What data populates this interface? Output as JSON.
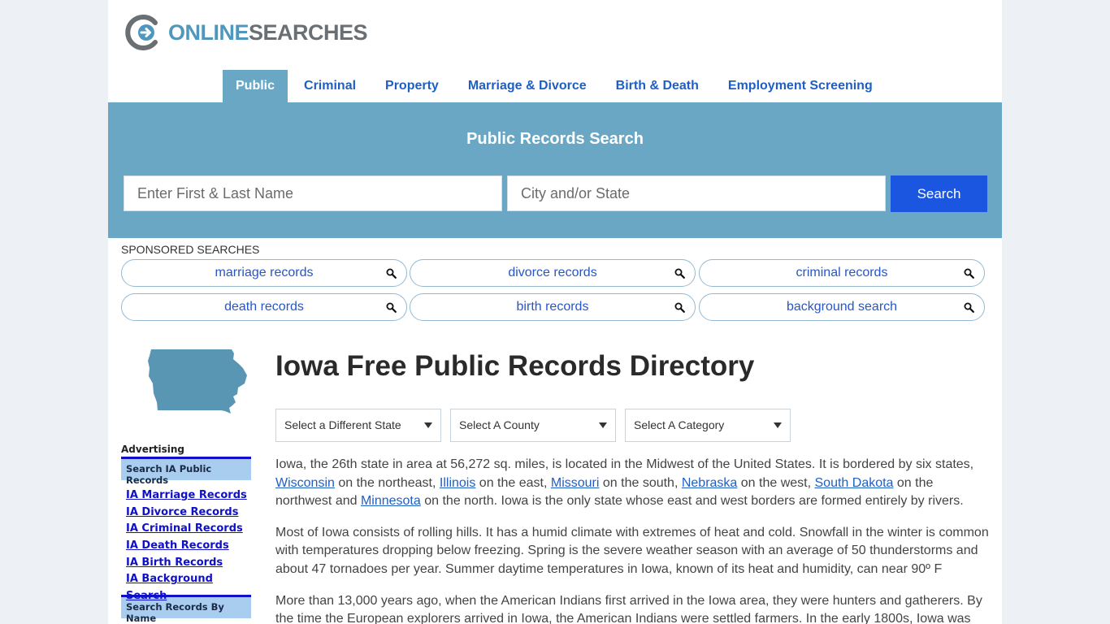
{
  "brand": {
    "online": "ONLINE",
    "searches": "SEARCHES",
    "accent": "#4f97bd"
  },
  "nav": [
    {
      "label": "Public",
      "active": true
    },
    {
      "label": "Criminal"
    },
    {
      "label": "Property"
    },
    {
      "label": "Marriage & Divorce"
    },
    {
      "label": "Birth & Death"
    },
    {
      "label": "Employment Screening"
    }
  ],
  "search": {
    "title": "Public Records Search",
    "name_placeholder": "Enter First & Last Name",
    "city_placeholder": "City and/or State",
    "button": "Search"
  },
  "sponsored": {
    "title": "SPONSORED SEARCHES",
    "items": [
      "marriage records",
      "divorce records",
      "criminal records",
      "death records",
      "birth records",
      "background search"
    ]
  },
  "sidebar": {
    "advertising": "Advertising",
    "section1": "Search IA Public Records",
    "links": [
      "IA Marriage Records",
      "IA Divorce Records",
      "IA Criminal Records",
      "IA Death Records",
      "IA Birth Records",
      "IA Background Search"
    ],
    "section2": "Search Records By Name"
  },
  "main": {
    "title": "Iowa Free Public Records Directory",
    "selects": [
      "Select a Different State",
      "Select A County",
      "Select A Category"
    ],
    "p1": {
      "t1": "Iowa, the 26th state in area at 56,272 sq. miles, is located in the Midwest of the United States. It is bordered by six states, ",
      "l1": "Wisconsin",
      "t2": " on the northeast, ",
      "l2": "Illinois",
      "t3": " on the east, ",
      "l3": "Missouri",
      "t4": " on the south, ",
      "l4": "Nebraska",
      "t5": " on the west, ",
      "l5": "South Dakota",
      "t6": " on the northwest and ",
      "l6": "Minnesota",
      "t7": " on the north. Iowa is the only state whose east and west borders are formed entirely by rivers."
    },
    "p2": "Most of Iowa consists of rolling hills. It has a humid climate with extremes of heat and cold. Snowfall in the winter is common with temperatures dropping below freezing. Spring is the severe weather season with an average of 50 thunderstorms and about 47 tornadoes per year. Summer daytime temperatures in Iowa, known of its heat and humidity, can near 90º F",
    "p3": "More than 13,000 years ago, when the American Indians first arrived in the Iowa area, they were hunters and gatherers. By the time the European explorers arrived in Iowa, the American Indians were settled farmers. In the early 1800s, Iowa was"
  }
}
